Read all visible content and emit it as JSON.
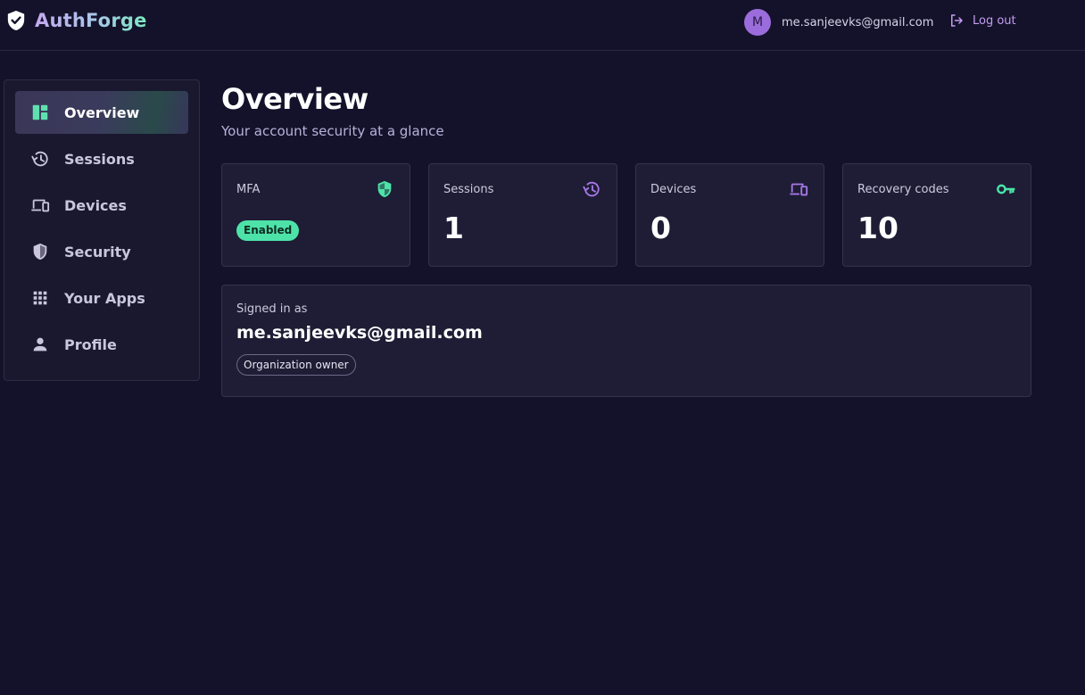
{
  "brand": {
    "name": "AuthForge",
    "icon": "shield-check-icon"
  },
  "header": {
    "avatar_initial": "M",
    "user_email": "me.sanjeevks@gmail.com",
    "logout_label": "Log out",
    "logout_icon": "logout-icon"
  },
  "sidebar": {
    "items": [
      {
        "label": "Overview",
        "icon": "dashboard-icon",
        "active": true
      },
      {
        "label": "Sessions",
        "icon": "history-icon",
        "active": false
      },
      {
        "label": "Devices",
        "icon": "devices-icon",
        "active": false
      },
      {
        "label": "Security",
        "icon": "shield-icon",
        "active": false
      },
      {
        "label": "Your Apps",
        "icon": "apps-grid-icon",
        "active": false
      },
      {
        "label": "Profile",
        "icon": "person-icon",
        "active": false
      }
    ]
  },
  "main": {
    "title": "Overview",
    "subtitle": "Your account security at a glance",
    "cards": [
      {
        "label": "MFA",
        "badge": "Enabled",
        "icon": "shield-check-icon"
      },
      {
        "label": "Sessions",
        "value": "1",
        "icon": "history-icon"
      },
      {
        "label": "Devices",
        "value": "0",
        "icon": "devices-icon"
      },
      {
        "label": "Recovery codes",
        "value": "10",
        "icon": "key-icon"
      }
    ],
    "signed_in": {
      "label": "Signed in as",
      "email": "me.sanjeevks@gmail.com",
      "role": "Organization owner"
    }
  },
  "colors": {
    "background": "#13122a",
    "panel": "#1e1d35",
    "accent_green": "#4de3a8",
    "accent_purple": "#a878e8",
    "avatar": "#9b6cdc"
  }
}
